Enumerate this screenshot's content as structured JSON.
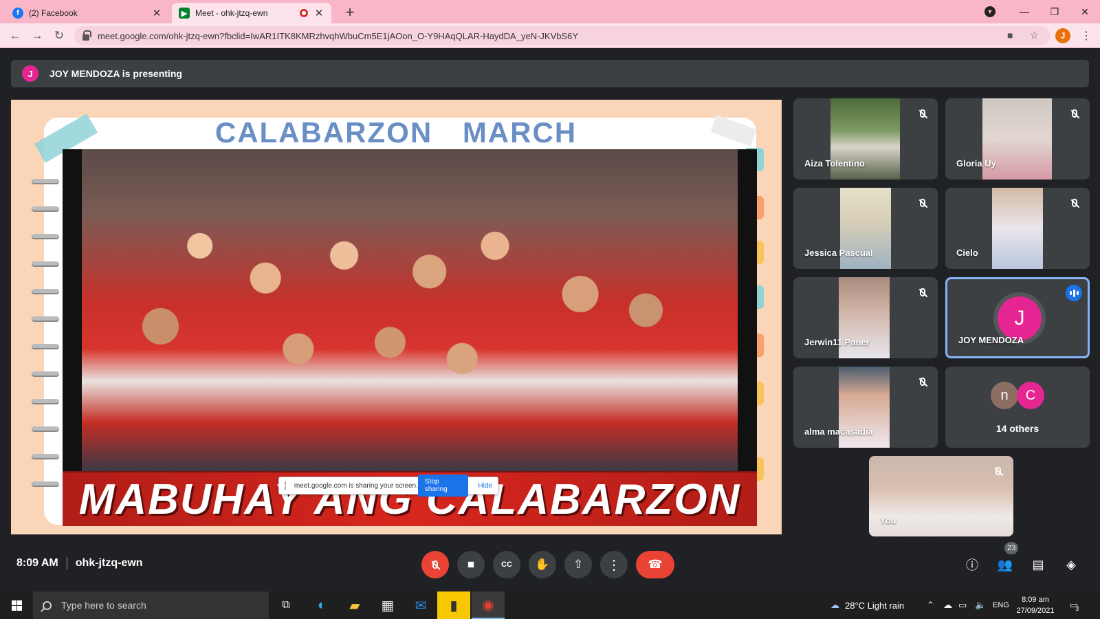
{
  "browser": {
    "tabs": [
      {
        "title": "(2) Facebook",
        "favicon": "facebook-icon"
      },
      {
        "title": "Meet - ohk-jtzq-ewn",
        "favicon": "google-meet-icon",
        "recording": true
      }
    ],
    "url": "meet.google.com/ohk-jtzq-ewn?fbclid=IwAR1ITK8KMRzhvqhWbuCm5E1jAOon_O-Y9HAqQLAR-HaydDA_yeN-JKVbS6Y",
    "profile_initial": "J"
  },
  "meet": {
    "presenter": {
      "initial": "J",
      "text": "JOY MENDOZA is presenting"
    },
    "slide": {
      "title": "CALABARZON MARCH",
      "banner": "MABUHAY ANG CALABARZON"
    },
    "share_popup": {
      "message": "meet.google.com is sharing your screen.",
      "stop_label": "Stop sharing",
      "hide_label": "Hide"
    },
    "participants": [
      {
        "name": "Aiza Tolentino",
        "muted": true
      },
      {
        "name": "Gloria Uy",
        "muted": true
      },
      {
        "name": "Jessica Pascual",
        "muted": true
      },
      {
        "name": "Cielo",
        "muted": true
      },
      {
        "name": "Jerwin11 Paner",
        "muted": true
      },
      {
        "name": "JOY MENDOZA",
        "initial": "J",
        "speaking": true
      },
      {
        "name": "alma macasadia",
        "muted": true
      }
    ],
    "others": {
      "initials": [
        "n",
        "C"
      ],
      "label": "14 others"
    },
    "self": {
      "name": "You",
      "muted": true
    },
    "time": "8:09 AM",
    "meeting_code": "ohk-jtzq-ewn",
    "people_count": "23"
  },
  "taskbar": {
    "search_placeholder": "Type here to search",
    "weather": "28°C  Light rain",
    "language": "ENG",
    "time": "8:09 am",
    "date": "27/09/2021",
    "notifications": "3"
  },
  "colors": {
    "tab_bar": "#f8b6c8",
    "meet_bg": "#202124",
    "tile_bg": "#3c4043",
    "accent_red": "#ea4335",
    "avatar_pink": "#e52592"
  }
}
